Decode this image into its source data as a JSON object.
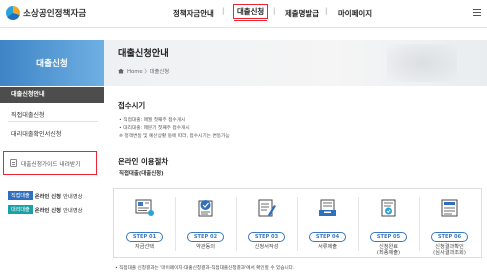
{
  "header": {
    "brand": "소상공인정책자금",
    "nav": [
      "정책자금안내",
      "대출신청",
      "제출명발급",
      "마이페이지"
    ]
  },
  "sidebar": {
    "title": "대출신청",
    "items": [
      "대출신청안내",
      "직접대출신청",
      "대리대출확인서신청"
    ],
    "guide": "대출신청가이드 내려받기",
    "videos": [
      {
        "tag": "직접대출",
        "bold": "온라인 신청",
        "rest": "안내영상",
        "color": "#2f6fbd"
      },
      {
        "tag": "대리대출",
        "bold": "온라인 신청",
        "rest": "안내영상",
        "color": "#1aa1a5"
      }
    ]
  },
  "hero": {
    "title": "대출신청안내",
    "breadcrumb": "Home 〉대출신청"
  },
  "receipt": {
    "title": "접수시기",
    "lines": [
      "• 직접대출: 매월 첫째주 접수개시",
      "• 대리대출: 매분기 첫째주 접수개시",
      "※ 정책변동 및 예산상황 등에 따라, 접수시기는 변동가능"
    ]
  },
  "online": {
    "title": "온라인 이용절차",
    "subtitle": "직접대출(대출신청)"
  },
  "steps": [
    {
      "badge": "STEP 01",
      "label": "자금선택",
      "icon": "form-select-icon"
    },
    {
      "badge": "STEP 02",
      "label": "약관동의",
      "icon": "checklist-icon"
    },
    {
      "badge": "STEP 03",
      "label": "신청서작성",
      "icon": "write-form-icon"
    },
    {
      "badge": "STEP 04",
      "label": "서류제출",
      "icon": "document-submit-icon"
    },
    {
      "badge": "STEP 05",
      "label": "신청완료\n(최종제출)",
      "icon": "document-complete-icon"
    },
    {
      "badge": "STEP 06",
      "label": "신청결과확인\n(심사결과조회)",
      "icon": "result-list-icon"
    }
  ],
  "footer_note": "• 직접대출 신청결과는 '마이페이지-대출신청결과-직접대출신청결과'에서 확인할 수 있습니다.",
  "colors": {
    "accent": "#3b78c0",
    "highlight": "#e23"
  }
}
